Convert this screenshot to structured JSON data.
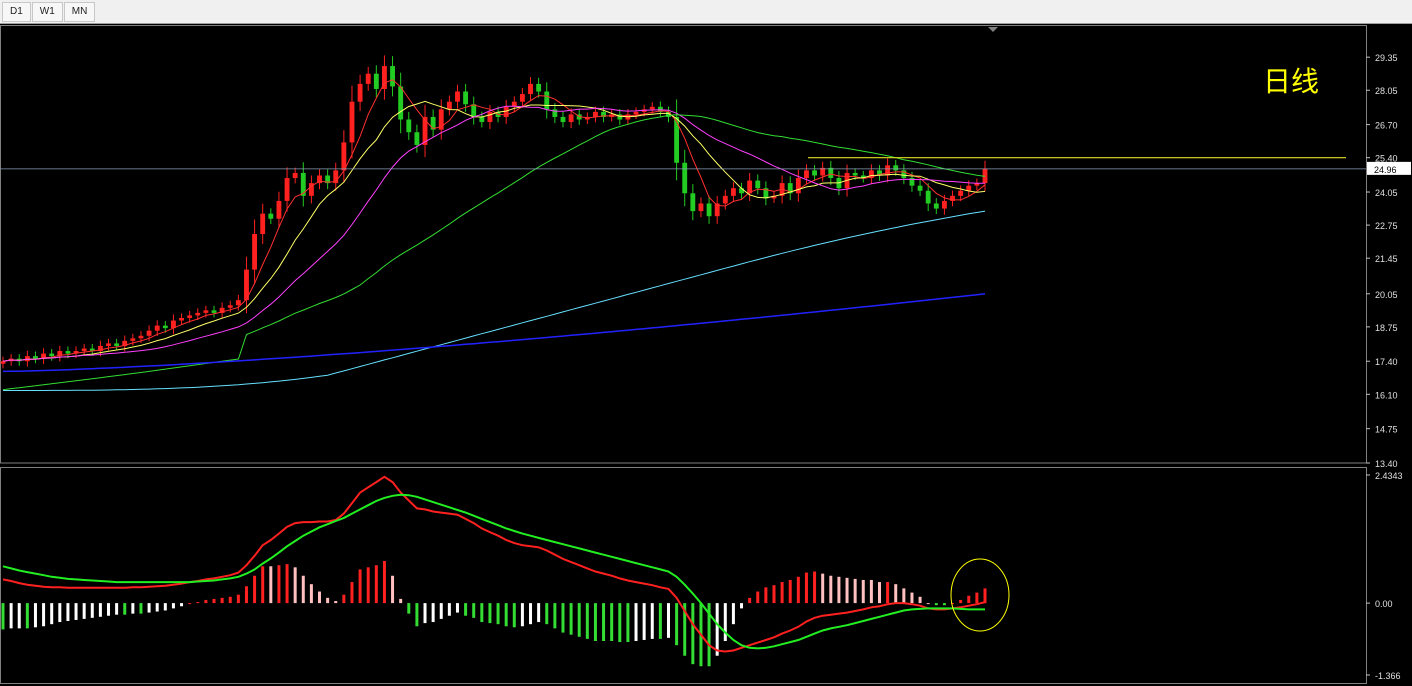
{
  "toolbar": {
    "timeframes": [
      "D1",
      "W1",
      "MN"
    ]
  },
  "colors": {
    "background": "#000000",
    "bullish_candle": "#ff2020",
    "bearish_candle": "#22cc22",
    "ma5": "#ff3030",
    "ma10": "#ffff66",
    "ma20": "#ff40ff",
    "ma60": "#33dd33",
    "ma120": "#66e0ff",
    "ma250": "#2222ff",
    "resistance": "#e0e020",
    "dif": "#ff2020",
    "dea": "#22ee22",
    "annotation": "#ffff00"
  },
  "annotation_text": "日线",
  "chart_data": [
    {
      "type": "candlestick",
      "title": "",
      "timeframe": "D1",
      "y_ticks": [
        "29.35",
        "28.05",
        "26.70",
        "25.40",
        "24.05",
        "22.75",
        "21.45",
        "20.05",
        "18.75",
        "17.40",
        "16.10",
        "14.75",
        "13.40"
      ],
      "ylim": [
        13.4,
        30.3
      ],
      "current_price": 24.96,
      "current_price_label": "24.96",
      "resistance_level": 25.4,
      "overlays": [
        "MA5",
        "MA10",
        "MA20",
        "MA60",
        "MA120",
        "MA250"
      ],
      "close_series": [
        17.4,
        17.5,
        17.4,
        17.6,
        17.5,
        17.7,
        17.6,
        17.8,
        17.7,
        17.8,
        17.9,
        17.8,
        18.0,
        18.1,
        18.0,
        18.2,
        18.3,
        18.4,
        18.6,
        18.8,
        18.7,
        19.0,
        19.1,
        19.2,
        19.3,
        19.4,
        19.3,
        19.5,
        19.6,
        19.8,
        21.0,
        22.4,
        23.2,
        23.0,
        23.7,
        24.6,
        24.8,
        23.9,
        24.4,
        24.7,
        24.4,
        24.9,
        26.0,
        27.6,
        28.3,
        28.7,
        28.1,
        29.0,
        28.2,
        26.9,
        26.4,
        25.9,
        27.0,
        26.5,
        27.3,
        27.6,
        28.0,
        27.5,
        27.0,
        26.8,
        27.2,
        27.0,
        27.4,
        27.6,
        27.9,
        28.3,
        28.0,
        27.3,
        27.0,
        26.8,
        27.1,
        26.9,
        27.0,
        27.2,
        27.0,
        27.1,
        26.9,
        27.1,
        27.2,
        27.3,
        27.4,
        27.2,
        27.0,
        25.2,
        24.0,
        23.3,
        23.6,
        23.1,
        23.6,
        23.9,
        24.2,
        24.0,
        24.5,
        24.2,
        23.8,
        23.9,
        24.4,
        24.0,
        24.6,
        24.9,
        24.7,
        25.0,
        24.6,
        24.2,
        24.8,
        24.7,
        24.6,
        24.9,
        24.7,
        25.1,
        24.9,
        24.6,
        24.3,
        24.1,
        23.6,
        23.4,
        23.7,
        23.9,
        24.1,
        24.3,
        24.4,
        24.96
      ]
    },
    {
      "type": "macd",
      "y_ticks": [
        "2.4343",
        "0.00",
        "-1.366"
      ],
      "ylim": [
        -1.366,
        2.4343
      ],
      "series": [
        {
          "name": "",
          "key": "dif"
        },
        {
          "name": "",
          "key": "dea"
        }
      ],
      "dif": [
        0.45,
        0.42,
        0.38,
        0.35,
        0.33,
        0.31,
        0.3,
        0.3,
        0.29,
        0.29,
        0.29,
        0.29,
        0.29,
        0.29,
        0.29,
        0.29,
        0.3,
        0.3,
        0.31,
        0.32,
        0.33,
        0.35,
        0.37,
        0.4,
        0.42,
        0.45,
        0.47,
        0.5,
        0.53,
        0.58,
        0.72,
        0.9,
        1.1,
        1.2,
        1.32,
        1.45,
        1.52,
        1.54,
        1.54,
        1.55,
        1.55,
        1.58,
        1.7,
        1.9,
        2.1,
        2.2,
        2.3,
        2.4,
        2.3,
        2.1,
        1.95,
        1.8,
        1.78,
        1.74,
        1.72,
        1.7,
        1.68,
        1.6,
        1.52,
        1.42,
        1.35,
        1.28,
        1.2,
        1.14,
        1.1,
        1.08,
        1.06,
        1.0,
        0.92,
        0.84,
        0.78,
        0.72,
        0.66,
        0.6,
        0.56,
        0.52,
        0.47,
        0.43,
        0.4,
        0.37,
        0.34,
        0.3,
        0.27,
        0.1,
        -0.15,
        -0.4,
        -0.6,
        -0.8,
        -0.9,
        -0.92,
        -0.9,
        -0.85,
        -0.8,
        -0.75,
        -0.7,
        -0.65,
        -0.58,
        -0.52,
        -0.45,
        -0.35,
        -0.28,
        -0.24,
        -0.22,
        -0.2,
        -0.18,
        -0.15,
        -0.12,
        -0.08,
        -0.06,
        -0.02,
        0.0,
        0.0,
        -0.02,
        -0.05,
        -0.1,
        -0.12,
        -0.12,
        -0.1,
        -0.08,
        -0.05,
        -0.02,
        0.02
      ],
      "dea": [
        0.7,
        0.66,
        0.62,
        0.59,
        0.56,
        0.53,
        0.5,
        0.48,
        0.46,
        0.45,
        0.44,
        0.43,
        0.42,
        0.41,
        0.4,
        0.4,
        0.4,
        0.4,
        0.4,
        0.4,
        0.4,
        0.4,
        0.4,
        0.4,
        0.41,
        0.42,
        0.43,
        0.45,
        0.47,
        0.5,
        0.56,
        0.64,
        0.75,
        0.85,
        0.96,
        1.08,
        1.18,
        1.28,
        1.36,
        1.44,
        1.5,
        1.56,
        1.62,
        1.7,
        1.78,
        1.86,
        1.94,
        2.0,
        2.04,
        2.06,
        2.05,
        2.02,
        1.97,
        1.92,
        1.87,
        1.82,
        1.77,
        1.72,
        1.66,
        1.6,
        1.54,
        1.48,
        1.42,
        1.37,
        1.32,
        1.28,
        1.24,
        1.2,
        1.16,
        1.12,
        1.08,
        1.04,
        1.0,
        0.96,
        0.92,
        0.88,
        0.84,
        0.8,
        0.76,
        0.72,
        0.68,
        0.64,
        0.6,
        0.5,
        0.35,
        0.18,
        0.0,
        -0.2,
        -0.4,
        -0.56,
        -0.7,
        -0.8,
        -0.85,
        -0.86,
        -0.85,
        -0.82,
        -0.78,
        -0.74,
        -0.7,
        -0.64,
        -0.58,
        -0.52,
        -0.48,
        -0.45,
        -0.42,
        -0.38,
        -0.34,
        -0.3,
        -0.26,
        -0.22,
        -0.18,
        -0.14,
        -0.12,
        -0.11,
        -0.1,
        -0.1,
        -0.1,
        -0.1,
        -0.11,
        -0.12,
        -0.12,
        -0.12
      ]
    }
  ]
}
